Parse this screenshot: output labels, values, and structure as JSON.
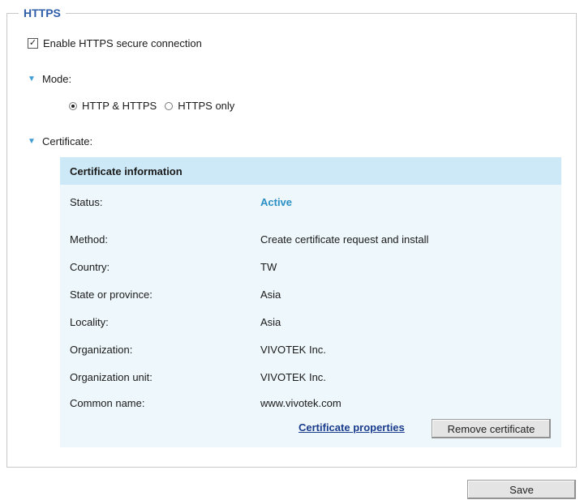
{
  "section": {
    "legend": "HTTPS"
  },
  "enable_https": {
    "label": "Enable HTTPS secure connection",
    "checked": true,
    "mark": "☑"
  },
  "mode": {
    "label": "Mode:",
    "chevron": "chevron-down-icon",
    "options": [
      {
        "label": "HTTP & HTTPS",
        "selected": true
      },
      {
        "label": "HTTPS only",
        "selected": false
      }
    ]
  },
  "certificate": {
    "label": "Certificate:",
    "chevron": "chevron-down-icon",
    "panel": {
      "header": "Certificate information",
      "rows": [
        {
          "label": "Status:",
          "value": "Active"
        },
        {
          "label": "Method:",
          "value": "Create certificate request and install"
        },
        {
          "label": "Country:",
          "value": "TW"
        },
        {
          "label": "State or province:",
          "value": "Asia"
        },
        {
          "label": "Locality:",
          "value": "Asia"
        },
        {
          "label": "Organization:",
          "value": "VIVOTEK Inc."
        },
        {
          "label": "Organization unit:",
          "value": "VIVOTEK Inc."
        },
        {
          "label": "Common name:",
          "value": "www.vivotek.com"
        }
      ],
      "properties_link": "Certificate properties",
      "remove_button": "Remove certificate"
    }
  },
  "save_button": "Save",
  "colors": {
    "legend": "#2f5ea8",
    "chevron": "#3d9bd6",
    "panel_header_bg": "#cde9f7",
    "panel_bg": "#eef7fb",
    "status_active": "#2a8fc4",
    "link": "#1a3c8c"
  }
}
